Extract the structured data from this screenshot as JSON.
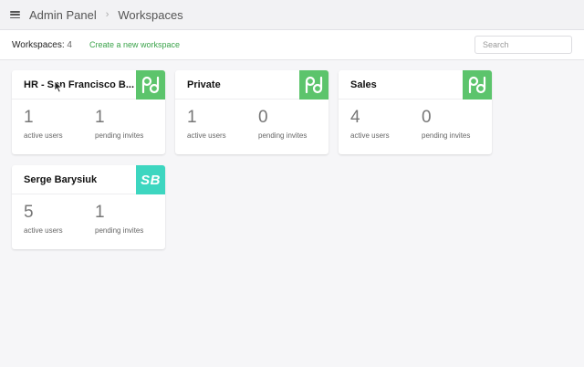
{
  "header": {
    "menu_icon": "hamburger-menu-icon",
    "breadcrumb": [
      "Admin Panel",
      "Workspaces"
    ]
  },
  "toolbar": {
    "count_label": "Workspaces:",
    "count_value": "4",
    "create_link": "Create a new workspace",
    "search_placeholder": "Search"
  },
  "colors": {
    "brand_green": "#5cc46c",
    "avatar_teal": "#3dd6c0",
    "link_green": "#3aa34a"
  },
  "workspaces": [
    {
      "name": "HR - San Francisco B...",
      "badge": "pd-logo-icon",
      "active_users": "1",
      "active_label": "active users",
      "pending_invites": "1",
      "pending_label": "pending invites"
    },
    {
      "name": "Private",
      "badge": "pd-logo-icon",
      "active_users": "1",
      "active_label": "active users",
      "pending_invites": "0",
      "pending_label": "pending invites"
    },
    {
      "name": "Sales",
      "badge": "pd-logo-icon",
      "active_users": "4",
      "active_label": "active users",
      "pending_invites": "0",
      "pending_label": "pending invites"
    },
    {
      "name": "Serge Barysiuk",
      "badge": "initials",
      "badge_text": "SB",
      "active_users": "5",
      "active_label": "active users",
      "pending_invites": "1",
      "pending_label": "pending invites"
    }
  ]
}
